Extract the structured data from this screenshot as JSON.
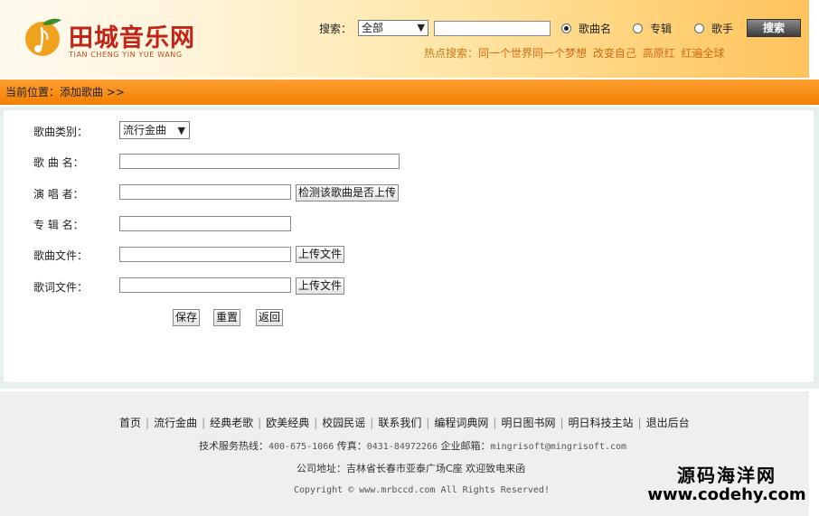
{
  "logo": {
    "title": "田城音乐网",
    "subtitle": "TIAN CHENG YIN YUE WANG"
  },
  "search": {
    "label": "搜索：",
    "scope_selected": "全部",
    "query_value": "",
    "radio_options": [
      {
        "label": "歌曲名",
        "checked": true
      },
      {
        "label": "专辑",
        "checked": false
      },
      {
        "label": "歌手",
        "checked": false
      }
    ],
    "button_label": "搜索",
    "hot_label": "热点搜索：",
    "hot_items": [
      "同一个世界同一个梦想",
      "改变自己",
      "高原红",
      "红遍全球"
    ]
  },
  "breadcrumb": {
    "text": "当前位置：添加歌曲 >>"
  },
  "form": {
    "category_label": "歌曲类别：",
    "category_selected": "流行金曲",
    "name_label": "歌 曲 名：",
    "name_value": "",
    "singer_label": "演 唱 者：",
    "singer_value": "",
    "check_button": "检测该歌曲是否上传",
    "album_label": "专 辑 名：",
    "album_value": "",
    "song_file_label": "歌曲文件：",
    "song_file_value": "",
    "upload_button": "上传文件",
    "lyric_file_label": "歌词文件：",
    "lyric_file_value": "",
    "lyric_upload_button": "上传文件",
    "save_button": "保存",
    "reset_button": "重置",
    "back_button": "返回"
  },
  "footer": {
    "links": [
      "首页",
      "流行金曲",
      "经典老歌",
      "欧美经典",
      "校园民谣",
      "联系我们",
      "编程词典网",
      "明日图书网",
      "明日科技主站",
      "退出后台"
    ],
    "hotline_label": "技术服务热线：",
    "hotline": "400-675-1066",
    "fax_label": "传真：",
    "fax": "0431-84972266",
    "email_label": "企业邮箱：",
    "email": "mingrisoft@mingrisoft.com",
    "address": "公司地址：吉林省长春市亚泰广场C座 欢迎致电来函",
    "copyright": "Copyright © www.mrbccd.com All Rights Reserved!"
  },
  "watermark": {
    "line1": "源码海洋网",
    "line2": "www.codehy.com"
  },
  "colors": {
    "accent_orange": "#f5880f",
    "logo_red": "#c22417",
    "hot_link": "#d06b14"
  }
}
